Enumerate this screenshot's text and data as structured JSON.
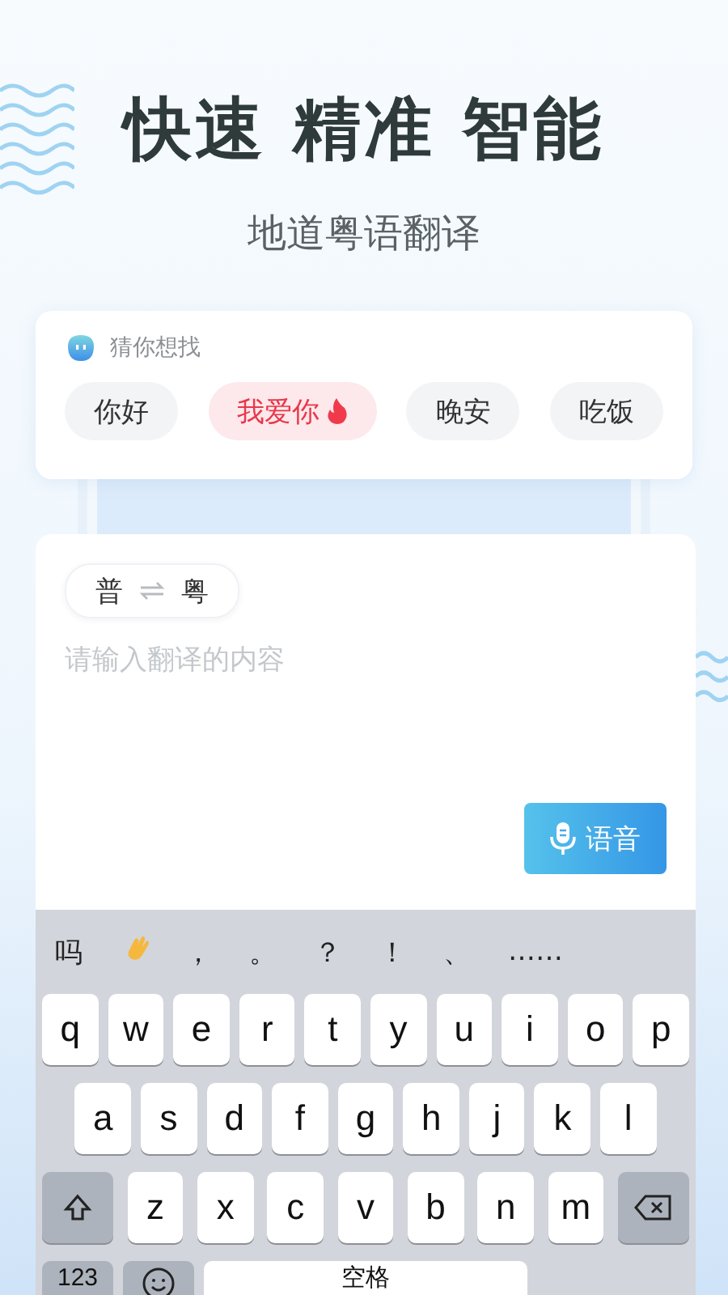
{
  "header": {
    "title": "快速 精准 智能",
    "subtitle": "地道粤语翻译"
  },
  "suggestions": {
    "label": "猜你想找",
    "chips": [
      {
        "text": "你好",
        "selected": false,
        "hot": false
      },
      {
        "text": "我爱你",
        "selected": true,
        "hot": true
      },
      {
        "text": "晚安",
        "selected": false,
        "hot": false
      },
      {
        "text": "吃饭",
        "selected": false,
        "hot": false
      }
    ]
  },
  "translator": {
    "source": "普",
    "target": "粤",
    "placeholder": "请输入翻译的内容",
    "voice_button": "语音"
  },
  "keyboard": {
    "candidates": [
      {
        "kind": "text",
        "text": "吗"
      },
      {
        "kind": "wave"
      },
      {
        "kind": "text",
        "text": "，"
      },
      {
        "kind": "text",
        "text": "。"
      },
      {
        "kind": "text",
        "text": "？"
      },
      {
        "kind": "text",
        "text": "！"
      },
      {
        "kind": "text",
        "text": "、"
      },
      {
        "kind": "text",
        "text": "……"
      }
    ],
    "rows": [
      [
        {
          "kind": "letter",
          "text": "q"
        },
        {
          "kind": "letter",
          "text": "w"
        },
        {
          "kind": "letter",
          "text": "e"
        },
        {
          "kind": "letter",
          "text": "r"
        },
        {
          "kind": "letter",
          "text": "t"
        },
        {
          "kind": "letter",
          "text": "y"
        },
        {
          "kind": "letter",
          "text": "u"
        },
        {
          "kind": "letter",
          "text": "i"
        },
        {
          "kind": "letter",
          "text": "o"
        },
        {
          "kind": "letter",
          "text": "p"
        }
      ],
      [
        {
          "kind": "letter",
          "text": "a"
        },
        {
          "kind": "letter",
          "text": "s"
        },
        {
          "kind": "letter",
          "text": "d"
        },
        {
          "kind": "letter",
          "text": "f"
        },
        {
          "kind": "letter",
          "text": "g"
        },
        {
          "kind": "letter",
          "text": "h"
        },
        {
          "kind": "letter",
          "text": "j"
        },
        {
          "kind": "letter",
          "text": "k"
        },
        {
          "kind": "letter",
          "text": "l"
        }
      ],
      [
        {
          "kind": "shift"
        },
        {
          "kind": "letter",
          "text": "z"
        },
        {
          "kind": "letter",
          "text": "x"
        },
        {
          "kind": "letter",
          "text": "c"
        },
        {
          "kind": "letter",
          "text": "v"
        },
        {
          "kind": "letter",
          "text": "b"
        },
        {
          "kind": "letter",
          "text": "n"
        },
        {
          "kind": "letter",
          "text": "m"
        },
        {
          "kind": "delete"
        }
      ]
    ],
    "bottom_row": [
      {
        "kind": "mode",
        "text": "123"
      },
      {
        "kind": "emoji"
      },
      {
        "kind": "space",
        "text": "空格"
      }
    ]
  }
}
